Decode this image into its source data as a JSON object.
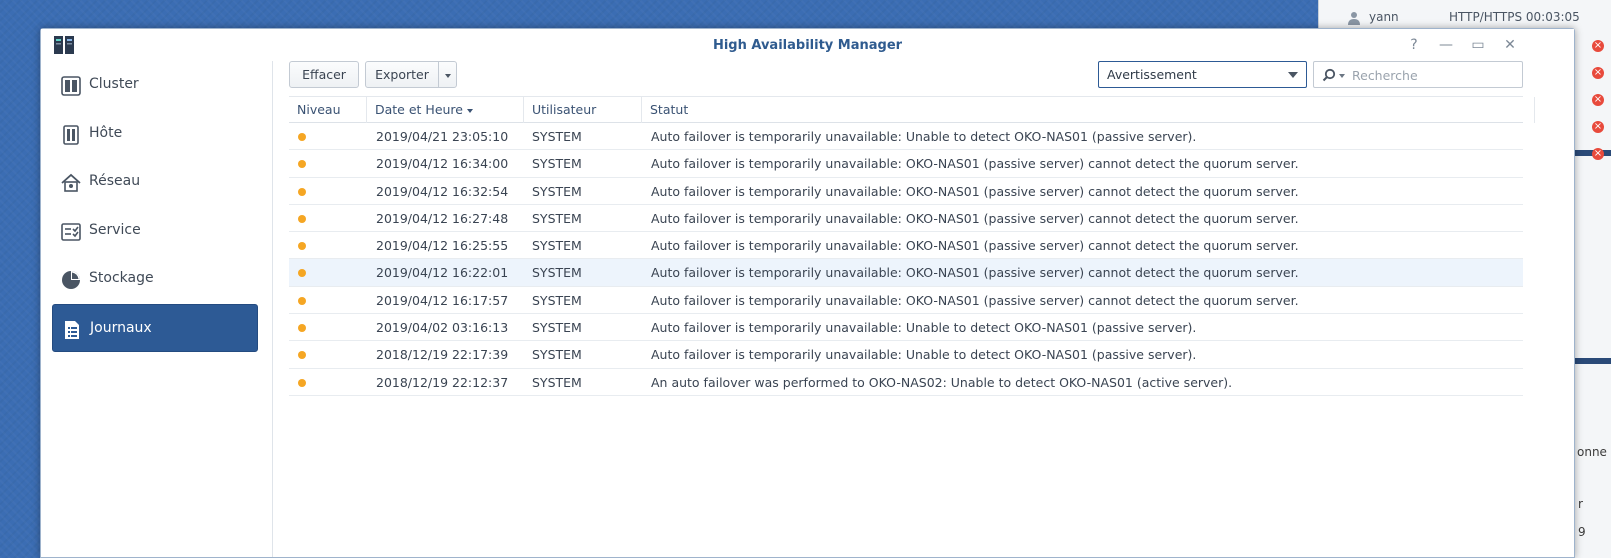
{
  "background": {
    "connections": [
      {
        "user": "yann",
        "info": "HTTP/HTTPS 00:03:05"
      }
    ],
    "fragments": [
      "onne d",
      "r",
      "9"
    ]
  },
  "window": {
    "title": "High Availability Manager",
    "controls": {
      "help": "?",
      "minimize": "—",
      "maximize": "▭",
      "close": "✕"
    }
  },
  "sidebar": {
    "items": [
      {
        "label": "Cluster",
        "icon": "cluster-icon"
      },
      {
        "label": "Hôte",
        "icon": "host-icon"
      },
      {
        "label": "Réseau",
        "icon": "network-icon"
      },
      {
        "label": "Service",
        "icon": "service-icon"
      },
      {
        "label": "Stockage",
        "icon": "storage-icon"
      },
      {
        "label": "Journaux",
        "icon": "logs-icon",
        "active": true
      }
    ]
  },
  "toolbar": {
    "clear_label": "Effacer",
    "export_label": "Exporter",
    "level_filter": "Avertissement",
    "search_placeholder": "Recherche"
  },
  "table": {
    "columns": [
      "Niveau",
      "Date et Heure",
      "Utilisateur",
      "Statut"
    ],
    "rows": [
      {
        "datetime": "2019/04/21 23:05:10",
        "user": "SYSTEM",
        "status": "Auto failover is temporarily unavailable: Unable to detect OKO-NAS01 (passive server)."
      },
      {
        "datetime": "2019/04/12 16:34:00",
        "user": "SYSTEM",
        "status": "Auto failover is temporarily unavailable: OKO-NAS01 (passive server) cannot detect the quorum server."
      },
      {
        "datetime": "2019/04/12 16:32:54",
        "user": "SYSTEM",
        "status": "Auto failover is temporarily unavailable: OKO-NAS01 (passive server) cannot detect the quorum server."
      },
      {
        "datetime": "2019/04/12 16:27:48",
        "user": "SYSTEM",
        "status": "Auto failover is temporarily unavailable: OKO-NAS01 (passive server) cannot detect the quorum server."
      },
      {
        "datetime": "2019/04/12 16:25:55",
        "user": "SYSTEM",
        "status": "Auto failover is temporarily unavailable: OKO-NAS01 (passive server) cannot detect the quorum server."
      },
      {
        "datetime": "2019/04/12 16:22:01",
        "user": "SYSTEM",
        "status": "Auto failover is temporarily unavailable: OKO-NAS01 (passive server) cannot detect the quorum server.",
        "selected": true
      },
      {
        "datetime": "2019/04/12 16:17:57",
        "user": "SYSTEM",
        "status": "Auto failover is temporarily unavailable: OKO-NAS01 (passive server) cannot detect the quorum server."
      },
      {
        "datetime": "2019/04/02 03:16:13",
        "user": "SYSTEM",
        "status": "Auto failover is temporarily unavailable: Unable to detect OKO-NAS01 (passive server)."
      },
      {
        "datetime": "2018/12/19 22:17:39",
        "user": "SYSTEM",
        "status": "Auto failover is temporarily unavailable: Unable to detect OKO-NAS01 (passive server)."
      },
      {
        "datetime": "2018/12/19 22:12:37",
        "user": "SYSTEM",
        "status": "An auto failover was performed to OKO-NAS02: Unable to detect OKO-NAS01 (active server)."
      }
    ]
  },
  "colors": {
    "accent": "#2d5a95",
    "warning_dot": "#f5a623",
    "desktop": "#3b6db3"
  }
}
